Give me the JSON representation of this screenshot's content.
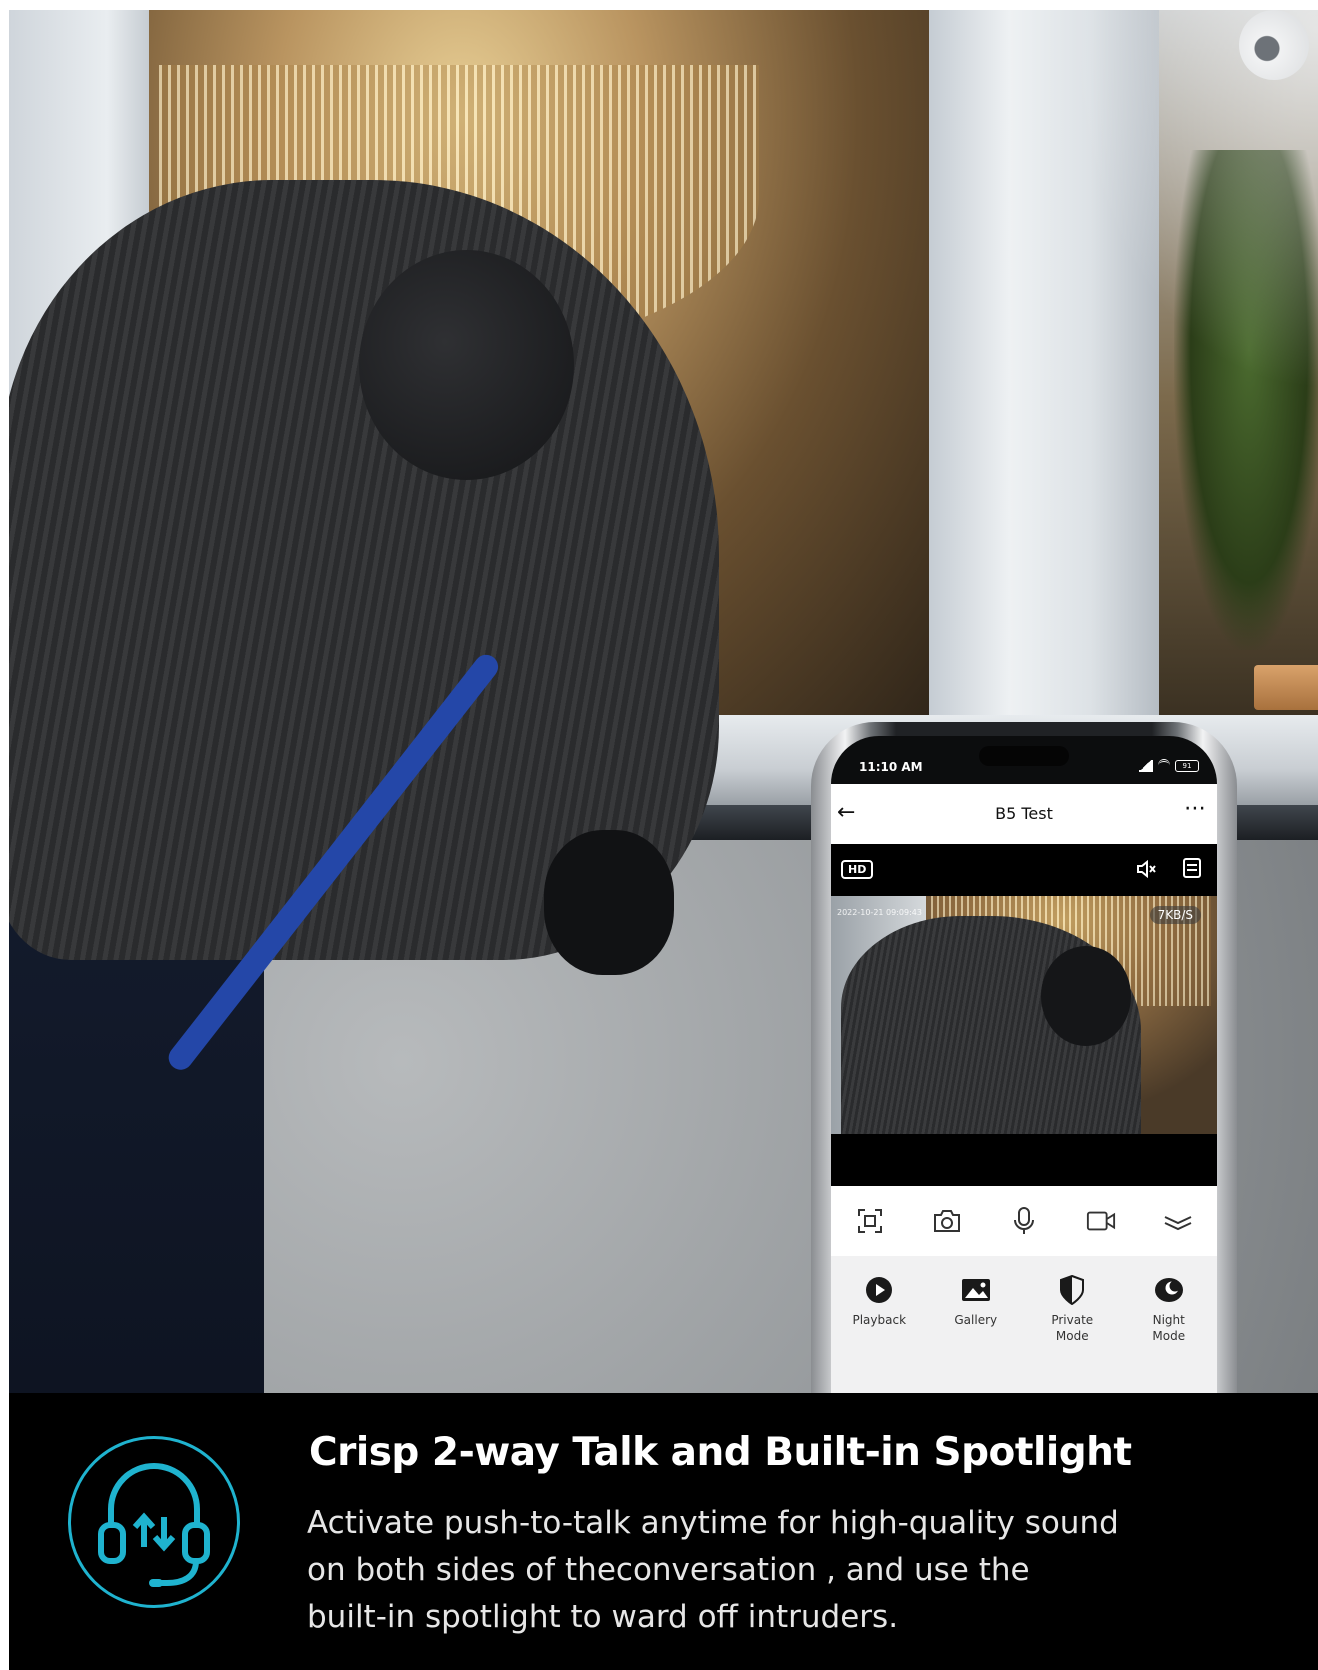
{
  "phone": {
    "status_time": "11:10 AM",
    "battery": "91",
    "app_title": "B5 Test",
    "quality_badge": "HD",
    "video_timestamp": "2022-10-21 09:09:43",
    "bitrate": "7KB/S",
    "controls": [
      "screenshot-frame-icon",
      "camera-icon",
      "microphone-icon",
      "video-record-icon",
      "collapse-chevron-icon"
    ],
    "features": {
      "playback": "Playback",
      "gallery": "Gallery",
      "private_line1": "Private",
      "private_line2": "Mode",
      "night_line1": "Night",
      "night_line2": "Mode"
    }
  },
  "caption": {
    "title": "Crisp 2-way Talk and Built-in Spotlight",
    "body_line1": "Activate push-to-talk anytime for high-quality sound",
    "body_line2": "on both sides of theconversation , and use the",
    "body_line3": "built-in spotlight to ward off intruders."
  },
  "colors": {
    "accent": "#1fb3cf",
    "caption_background": "#000000",
    "crowbar": "#2447a8"
  }
}
